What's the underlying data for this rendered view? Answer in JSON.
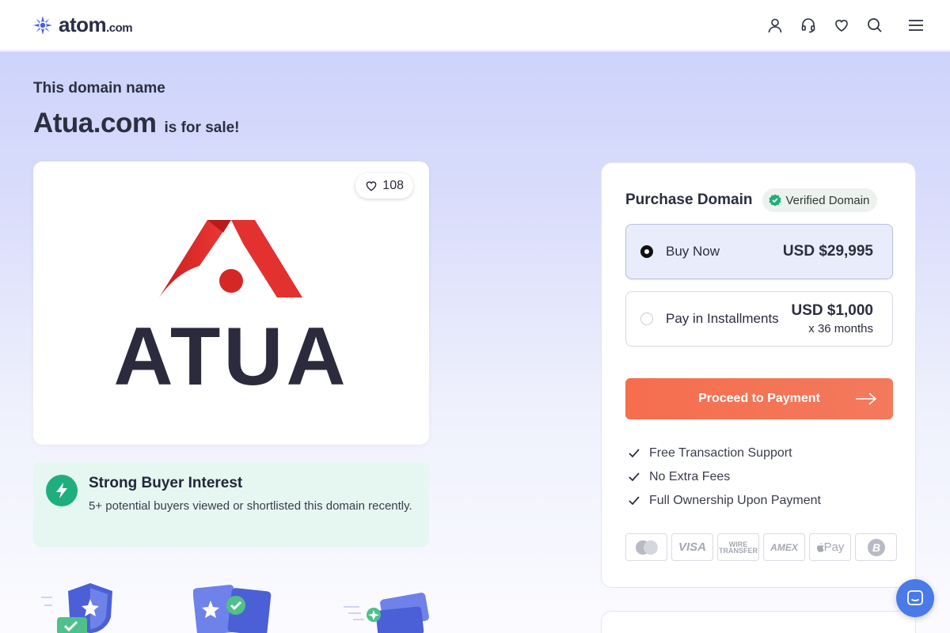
{
  "header": {
    "logo_main": "atom",
    "logo_suffix": ".com",
    "icons": [
      "user-icon",
      "headset-icon",
      "heart-icon",
      "search-icon",
      "menu-icon"
    ]
  },
  "hero": {
    "pre_title": "This domain name",
    "domain": "Atua.com",
    "suffix": "is for sale!"
  },
  "logo_card": {
    "likes": "108",
    "brand_text": "ATUA"
  },
  "interest": {
    "title": "Strong Buyer Interest",
    "text": "5+ potential buyers viewed or shortlisted this domain recently."
  },
  "purchase": {
    "title": "Purchase Domain",
    "verified": "Verified Domain",
    "options": [
      {
        "label": "Buy Now",
        "price": "USD $29,995",
        "sub": "",
        "selected": true
      },
      {
        "label": "Pay in Installments",
        "price": "USD $1,000",
        "sub": "x 36 months",
        "selected": false
      }
    ],
    "cta": "Proceed to Payment",
    "features": [
      "Free Transaction Support",
      "No Extra Fees",
      "Full Ownership Upon Payment"
    ],
    "payment_methods": [
      "mastercard",
      "VISA",
      "WIRE TRANSFER",
      "AMEX",
      "Pay",
      "bitcoin"
    ]
  },
  "colors": {
    "accent": "#f56e4e",
    "brand_red": "#e0282a",
    "brand_dark": "#2b2b3d",
    "success": "#1fae7e",
    "chat": "#4a7ae8"
  }
}
